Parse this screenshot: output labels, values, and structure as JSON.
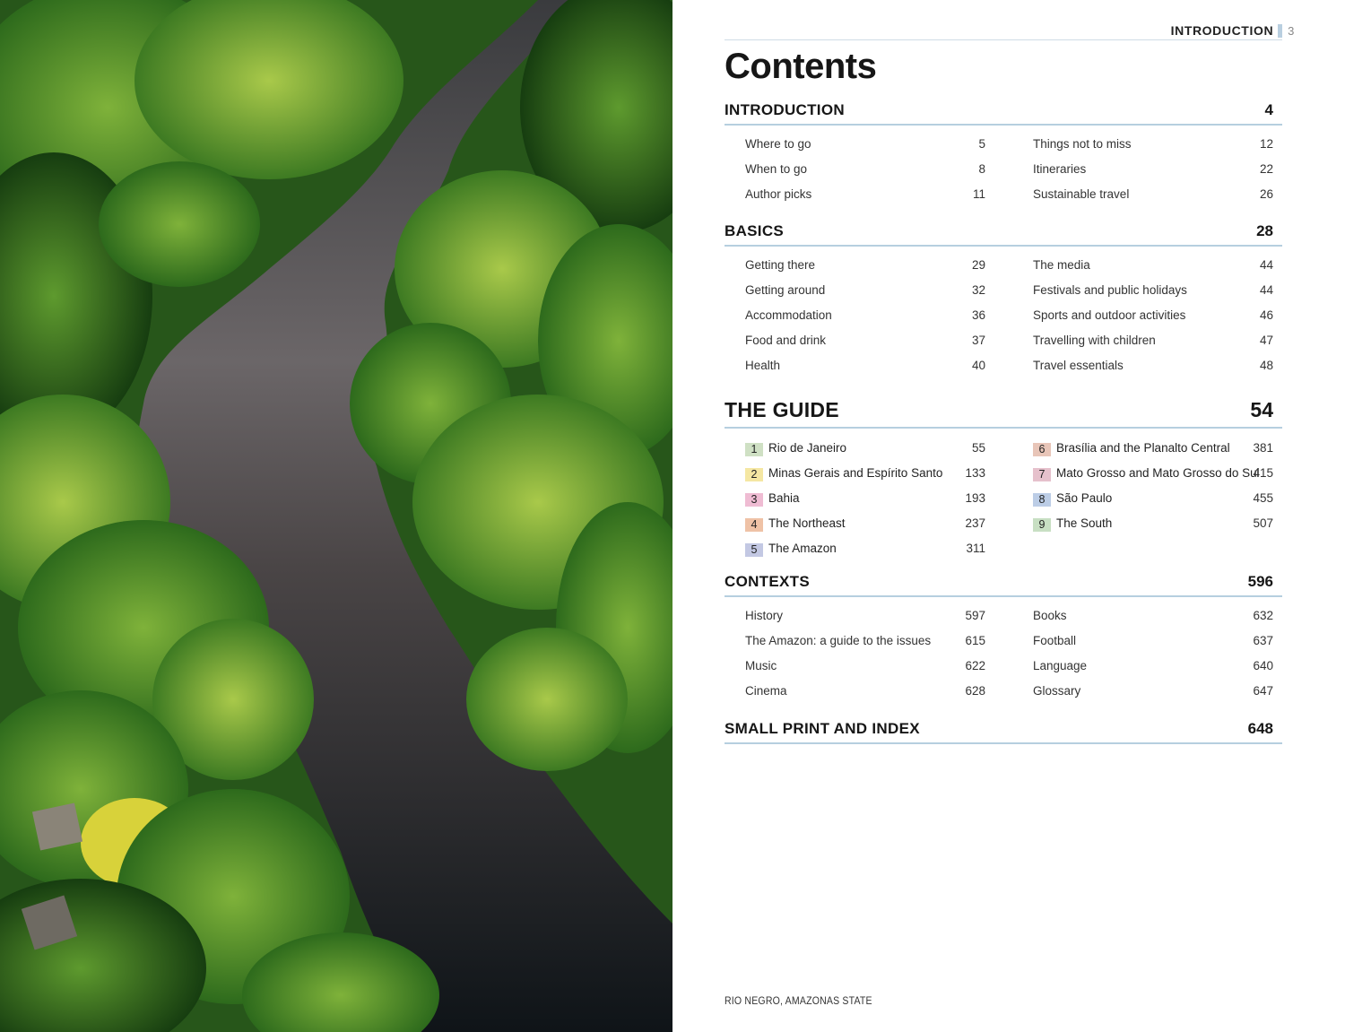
{
  "running_head": {
    "section": "INTRODUCTION",
    "page": "3"
  },
  "title": "Contents",
  "sections": {
    "introduction": {
      "name": "INTRODUCTION",
      "page": "4",
      "left": [
        {
          "label": "Where to go",
          "page": "5"
        },
        {
          "label": "When to go",
          "page": "8"
        },
        {
          "label": "Author picks",
          "page": "11"
        }
      ],
      "right": [
        {
          "label": "Things not to miss",
          "page": "12"
        },
        {
          "label": "Itineraries",
          "page": "22"
        },
        {
          "label": "Sustainable travel",
          "page": "26"
        }
      ]
    },
    "basics": {
      "name": "BASICS",
      "page": "28",
      "left": [
        {
          "label": "Getting there",
          "page": "29"
        },
        {
          "label": "Getting around",
          "page": "32"
        },
        {
          "label": "Accommodation",
          "page": "36"
        },
        {
          "label": "Food and drink",
          "page": "37"
        },
        {
          "label": "Health",
          "page": "40"
        }
      ],
      "right": [
        {
          "label": "The media",
          "page": "44"
        },
        {
          "label": "Festivals and public holidays",
          "page": "44"
        },
        {
          "label": "Sports and outdoor activities",
          "page": "46"
        },
        {
          "label": "Travelling with children",
          "page": "47"
        },
        {
          "label": "Travel essentials",
          "page": "48"
        }
      ]
    },
    "guide": {
      "name": "THE GUIDE",
      "page": "54",
      "left": [
        {
          "num": "1",
          "label": "Rio de Janeiro",
          "page": "55",
          "color": "#cfe0c4"
        },
        {
          "num": "2",
          "label": "Minas Gerais and Espírito Santo",
          "page": "133",
          "color": "#f5e7a3"
        },
        {
          "num": "3",
          "label": "Bahia",
          "page": "193",
          "color": "#efbcd3"
        },
        {
          "num": "4",
          "label": "The Northeast",
          "page": "237",
          "color": "#efc2a6"
        },
        {
          "num": "5",
          "label": "The Amazon",
          "page": "311",
          "color": "#c3c8e3"
        }
      ],
      "right": [
        {
          "num": "6",
          "label": "Brasília and the Planalto Central",
          "page": "381",
          "color": "#e8c5b8"
        },
        {
          "num": "7",
          "label": "Mato Grosso and Mato Grosso do Sul",
          "page": "415",
          "color": "#e6c1cc"
        },
        {
          "num": "8",
          "label": "São Paulo",
          "page": "455",
          "color": "#bccde6"
        },
        {
          "num": "9",
          "label": "The South",
          "page": "507",
          "color": "#c8dfc3"
        }
      ]
    },
    "contexts": {
      "name": "CONTEXTS",
      "page": "596",
      "left": [
        {
          "label": "History",
          "page": "597"
        },
        {
          "label": "The Amazon: a guide to the issues",
          "page": "615"
        },
        {
          "label": "Music",
          "page": "622"
        },
        {
          "label": "Cinema",
          "page": "628"
        }
      ],
      "right": [
        {
          "label": "Books",
          "page": "632"
        },
        {
          "label": "Football",
          "page": "637"
        },
        {
          "label": "Language",
          "page": "640"
        },
        {
          "label": "Glossary",
          "page": "647"
        }
      ]
    },
    "small_print": {
      "name": "SMALL PRINT AND INDEX",
      "page": "648"
    }
  },
  "caption": "RIO NEGRO, AMAZONAS STATE"
}
